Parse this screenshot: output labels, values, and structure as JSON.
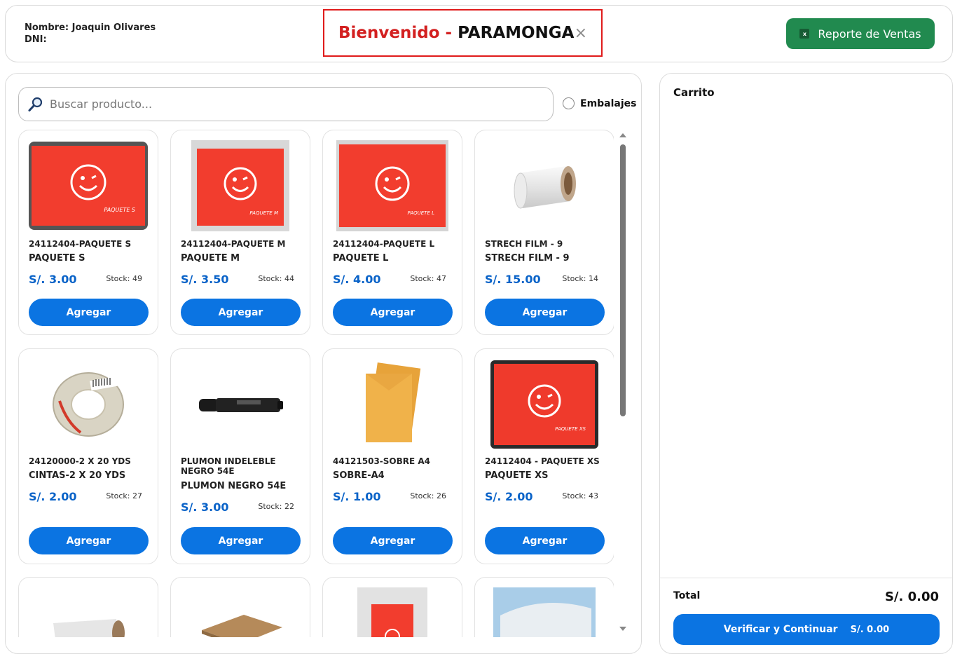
{
  "header": {
    "name_line": "Nombre: Joaquin Olivares",
    "dni_line": "DNI:",
    "welcome": "Bienvenido",
    "separator": "-",
    "branch": "PARAMONGA",
    "close_symbol": "×",
    "report_button": "Reporte de Ventas",
    "excel_badge": "x"
  },
  "search": {
    "placeholder": "Buscar producto..."
  },
  "filter": {
    "label": "Embalajes"
  },
  "add_label": "Agregar",
  "products": [
    {
      "code": "24112404-PAQUETE S",
      "name": "PAQUETE S",
      "price": "S/. 3.00",
      "stock": "Stock: 49",
      "tag": "PAQUETE S"
    },
    {
      "code": "24112404-PAQUETE M",
      "name": "PAQUETE M",
      "price": "S/. 3.50",
      "stock": "Stock: 44",
      "tag": "PAQUETE M"
    },
    {
      "code": "24112404-PAQUETE L",
      "name": "PAQUETE L",
      "price": "S/. 4.00",
      "stock": "Stock: 47",
      "tag": "PAQUETE L"
    },
    {
      "code": "STRECH FILM - 9",
      "name": "STRECH FILM - 9",
      "price": "S/. 15.00",
      "stock": "Stock: 14"
    },
    {
      "code": "24120000-2 X 20 YDS",
      "name": "CINTAS-2 X 20 YDS",
      "price": "S/. 2.00",
      "stock": "Stock: 27"
    },
    {
      "code": "PLUMON INDELEBLE NEGRO 54E",
      "name": "PLUMON NEGRO 54E",
      "price": "S/. 3.00",
      "stock": "Stock: 22"
    },
    {
      "code": "44121503-SOBRE A4",
      "name": "SOBRE-A4",
      "price": "S/. 1.00",
      "stock": "Stock: 26"
    },
    {
      "code": "24112404 - PAQUETE XS",
      "name": "PAQUETE XS",
      "price": "S/. 2.00",
      "stock": "Stock: 43",
      "tag": "PAQUETE XS"
    }
  ],
  "cart": {
    "title": "Carrito",
    "total_label": "Total",
    "total_value": "S/. 0.00",
    "verify_label": "Verificar y Continuar",
    "verify_amount": "S/. 0.00"
  },
  "colors": {
    "primary": "#0b74e2",
    "brand_red": "#d32020",
    "excel_green": "#218a4f"
  }
}
